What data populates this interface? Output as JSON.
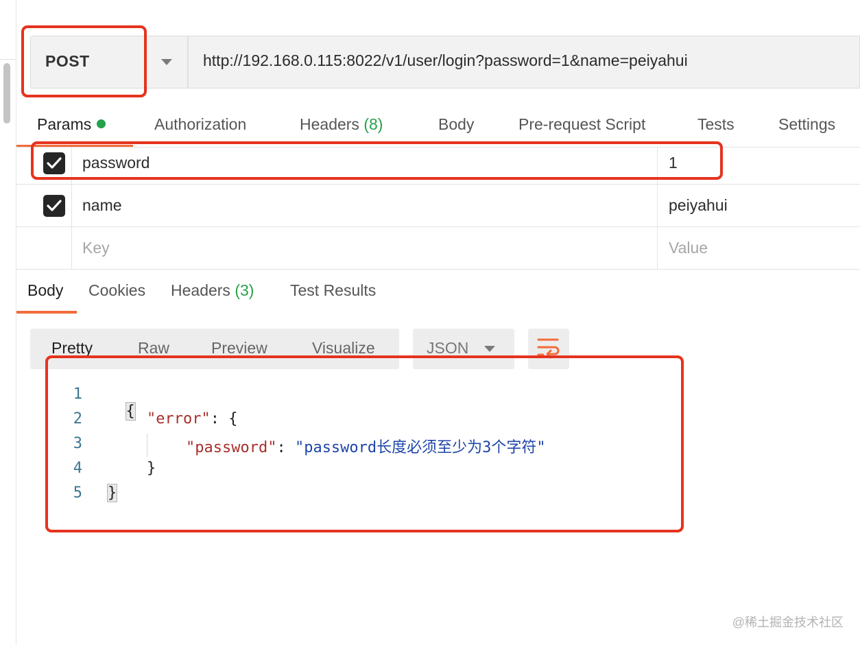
{
  "request": {
    "method": "POST",
    "url": "http://192.168.0.115:8022/v1/user/login?password=1&name=peiyahui"
  },
  "request_tabs": [
    {
      "label": "Params",
      "count": ""
    },
    {
      "label": "Authorization",
      "count": ""
    },
    {
      "label": "Headers",
      "count": "(8)"
    },
    {
      "label": "Body",
      "count": ""
    },
    {
      "label": "Pre-request Script",
      "count": ""
    },
    {
      "label": "Tests",
      "count": ""
    },
    {
      "label": "Settings",
      "count": ""
    }
  ],
  "params": {
    "rows": [
      {
        "key": "password",
        "value": "1",
        "checked": true
      },
      {
        "key": "name",
        "value": "peiyahui",
        "checked": true
      }
    ],
    "key_placeholder": "Key",
    "value_placeholder": "Value"
  },
  "response_tabs": [
    {
      "label": "Body",
      "count": ""
    },
    {
      "label": "Cookies",
      "count": ""
    },
    {
      "label": "Headers",
      "count": "(3)"
    },
    {
      "label": "Test Results",
      "count": ""
    }
  ],
  "response_toolbar": {
    "formats": [
      "Pretty",
      "Raw",
      "Preview",
      "Visualize"
    ],
    "language": "JSON"
  },
  "response_body": {
    "line_numbers": [
      "1",
      "2",
      "3",
      "4",
      "5"
    ],
    "open_brace": "{",
    "error_key": "\"error\"",
    "colon_brace": ": {",
    "password_key": "\"password\"",
    "colon": ": ",
    "password_message": "\"password长度必须至少为3个字符\"",
    "inner_close": "}",
    "close_brace": "}"
  },
  "watermark": "@稀土掘金技术社区",
  "colors": {
    "accent": "#f26b3a",
    "annotation_red": "#e5331e",
    "count_green": "#26a14b"
  }
}
